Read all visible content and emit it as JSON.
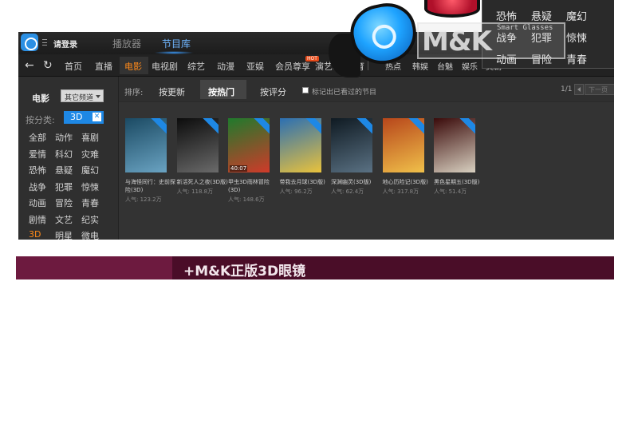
{
  "topbar": {
    "login": "请登录",
    "tabs": [
      {
        "label": "播放器",
        "active": false
      },
      {
        "label": "节目库",
        "active": true
      }
    ]
  },
  "navbar": {
    "back_icon": "back-arrow-icon",
    "refresh_icon": "refresh-icon",
    "items": [
      "首页",
      "直播",
      "电影",
      "电视剧",
      "综艺",
      "动漫",
      "亚娱",
      "会员尊享",
      "演艺吧",
      "体育",
      "热点",
      "韩娱",
      "台魅",
      "娱乐",
      "美剧"
    ],
    "active": "电影",
    "hot_badge": "HOT"
  },
  "sidebar": {
    "title": "电影",
    "channel_select": "其它频道",
    "category_label": "按分类:",
    "category_chip": "3D",
    "genres": [
      [
        "全部",
        "动作",
        "喜剧"
      ],
      [
        "爱情",
        "科幻",
        "灾难"
      ],
      [
        "恐怖",
        "悬疑",
        "魔幻"
      ],
      [
        "战争",
        "犯罪",
        "惊悚"
      ],
      [
        "动画",
        "冒险",
        "青春"
      ],
      [
        "剧情",
        "文艺",
        "纪实"
      ],
      [
        "3D",
        "明星",
        "微电"
      ]
    ],
    "active_genre": "3D"
  },
  "sortbar": {
    "label": "排序:",
    "options": [
      "按更新",
      "按热门",
      "按评分"
    ],
    "active": "按热门",
    "mark_label": "标记出已看过的节目",
    "page": "1/1",
    "next": "下一页"
  },
  "posters": [
    {
      "title": "与海怪同行：史前探险(3D)",
      "pop": "人气: 123.2万",
      "colors": [
        "#1b4a63",
        "#6aa3c2"
      ]
    },
    {
      "title": "新活死人之夜(3D版)",
      "pop": "人气: 118.8万",
      "colors": [
        "#0c0c0c",
        "#6a6a6a"
      ]
    },
    {
      "title": "甲虫3D雨林冒险(3D)",
      "pop": "人气: 148.6万",
      "colors": [
        "#1f7a2c",
        "#d03a2a"
      ],
      "dur": "40:07"
    },
    {
      "title": "带我去月球(3D版)",
      "pop": "人气: 96.2万",
      "colors": [
        "#2b6fb3",
        "#e9c23c"
      ]
    },
    {
      "title": "深渊幽灵(3D版)",
      "pop": "人气: 62.4万",
      "colors": [
        "#0f1a22",
        "#5a7183"
      ]
    },
    {
      "title": "地心历险记(3D版)",
      "pop": "人气: 317.8万",
      "colors": [
        "#b7461b",
        "#f0c04a"
      ]
    },
    {
      "title": "黑色星期五(3D版)",
      "pop": "人气: 51.4万",
      "colors": [
        "#3a0a0a",
        "#d8d0c0"
      ]
    }
  ],
  "popup": {
    "genres": [
      [
        "恐怖",
        "悬疑",
        "魔幻"
      ],
      [
        "战争",
        "犯罪",
        "惊悚"
      ],
      [
        "动画",
        "冒险",
        "青春"
      ]
    ]
  },
  "watermark": {
    "brand": "M&K",
    "sub": "Smart Glasses"
  },
  "banner": {
    "text": "+M&K正版3D眼镜"
  }
}
